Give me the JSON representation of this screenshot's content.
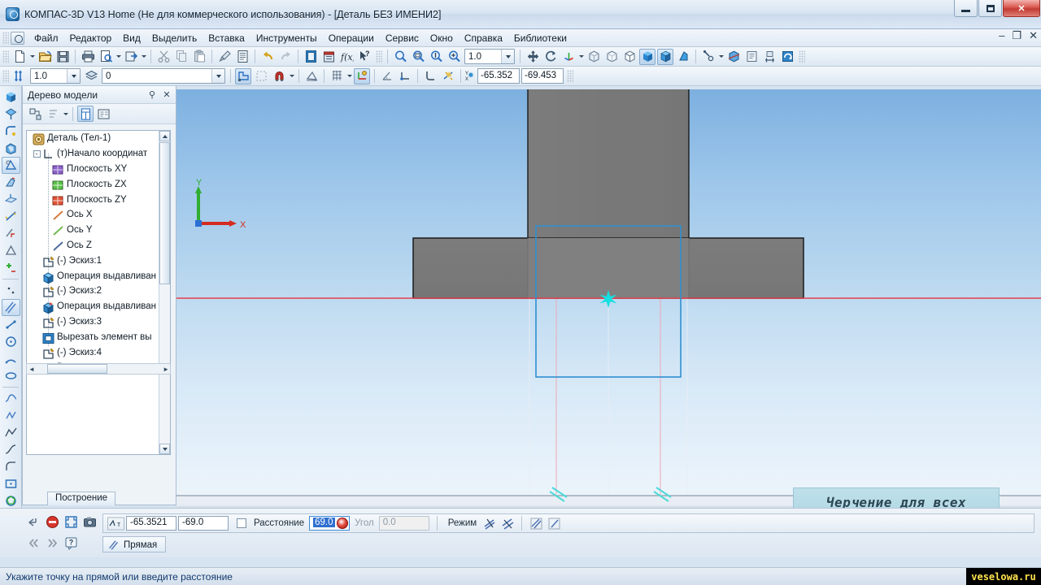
{
  "window": {
    "title": "КОМПАС-3D V13 Home (Не для коммерческого использования) - [Деталь БЕЗ ИМЕНИ2]",
    "app_icon": "kompas-logo-icon",
    "minimize_label": "—",
    "maximize_label": "□",
    "close_label": "✕",
    "doc_minimize_label": "–",
    "doc_restore_label": "❐",
    "doc_close_label": "✕"
  },
  "menu": {
    "items": [
      {
        "label": "Файл"
      },
      {
        "label": "Редактор"
      },
      {
        "label": "Вид"
      },
      {
        "label": "Выделить"
      },
      {
        "label": "Вставка"
      },
      {
        "label": "Инструменты"
      },
      {
        "label": "Операции"
      },
      {
        "label": "Сервис"
      },
      {
        "label": "Окно"
      },
      {
        "label": "Справка"
      },
      {
        "label": "Библиотеки"
      }
    ]
  },
  "toolbar_standard": {
    "buttons": [
      {
        "name": "new-document-icon",
        "glyph": "page"
      },
      {
        "name": "new-document-dropdown-icon",
        "glyph": "caret"
      },
      {
        "name": "open-document-icon",
        "glyph": "folder"
      },
      {
        "name": "save-document-icon",
        "glyph": "floppy"
      },
      {
        "name": "print-icon",
        "glyph": "printer"
      },
      {
        "name": "print-preview-icon",
        "glyph": "preview"
      },
      {
        "name": "print-preview-dropdown-icon",
        "glyph": "caret"
      },
      {
        "name": "send-document-icon",
        "glyph": "send"
      },
      {
        "name": "send-document-dropdown-icon",
        "glyph": "caret"
      },
      {
        "name": "cut-icon",
        "glyph": "scissors"
      },
      {
        "name": "copy-icon",
        "glyph": "copy"
      },
      {
        "name": "paste-icon",
        "glyph": "paste"
      },
      {
        "name": "format-painter-icon",
        "glyph": "brush"
      },
      {
        "name": "properties-icon",
        "glyph": "list"
      },
      {
        "name": "undo-icon",
        "glyph": "undo"
      },
      {
        "name": "redo-icon",
        "glyph": "redo"
      },
      {
        "name": "manager-icon",
        "glyph": "book"
      },
      {
        "name": "variables-icon",
        "glyph": "vars"
      },
      {
        "name": "expression-icon",
        "glyph": "fx"
      },
      {
        "name": "context-help-icon",
        "glyph": "help-arrow"
      }
    ],
    "zoom_buttons": [
      {
        "name": "zoom-window-icon",
        "glyph": "magnifier"
      },
      {
        "name": "zoom-fit-icon",
        "glyph": "magnifier-fit"
      },
      {
        "name": "zoom-in-out-icon",
        "glyph": "magnifier-scale"
      },
      {
        "name": "zoom-step-icon",
        "glyph": "magnifier-plus"
      }
    ],
    "zoom_value": "1.0",
    "view_buttons": [
      {
        "name": "pan-icon",
        "glyph": "move"
      },
      {
        "name": "rotate-icon",
        "glyph": "rotate"
      },
      {
        "name": "orientation-icon",
        "glyph": "orientation"
      },
      {
        "name": "orientation-dropdown-icon",
        "glyph": "caret"
      },
      {
        "name": "wireframe-icon",
        "glyph": "cube-wire"
      },
      {
        "name": "hidden-lines-thin-icon",
        "glyph": "cube-hidden"
      },
      {
        "name": "no-hidden-lines-icon",
        "glyph": "cube-nohidden"
      },
      {
        "name": "shaded-with-edges-icon",
        "glyph": "cube-solid-edge"
      },
      {
        "name": "shaded-icon",
        "glyph": "cube-solid"
      },
      {
        "name": "perspective-icon",
        "glyph": "cube-persp"
      },
      {
        "name": "display-settings-icon",
        "glyph": "display"
      },
      {
        "name": "display-settings-dropdown-icon",
        "glyph": "caret"
      },
      {
        "name": "section-icon",
        "glyph": "section"
      },
      {
        "name": "simplify-icon",
        "glyph": "simplify"
      },
      {
        "name": "measure-icon",
        "glyph": "measure"
      },
      {
        "name": "rebuild-icon",
        "glyph": "rebuild"
      }
    ]
  },
  "toolbar_current_state": {
    "line_style_value": "1.0",
    "layer_value": "0",
    "buttons": [
      {
        "name": "line-weight-icon",
        "glyph": "weights"
      },
      {
        "name": "layer-manager-icon",
        "glyph": "layers"
      },
      {
        "name": "sketch-mode-icon",
        "glyph": "sketch"
      },
      {
        "name": "sketch-hidden-icon",
        "glyph": "sketch2"
      },
      {
        "name": "parametric-mode-icon",
        "glyph": "magnet"
      },
      {
        "name": "parametric-dropdown-icon",
        "glyph": "caret"
      },
      {
        "name": "snap-setup-icon",
        "glyph": "snap"
      },
      {
        "name": "grid-icon",
        "glyph": "grid"
      },
      {
        "name": "grid-dropdown-icon",
        "glyph": "caret"
      },
      {
        "name": "local-cs-icon",
        "glyph": "lcs"
      },
      {
        "name": "restrict-angle-icon",
        "glyph": "angle"
      },
      {
        "name": "local-origin-icon",
        "glyph": "origin"
      },
      {
        "name": "orthogonal-icon",
        "glyph": "ortho"
      },
      {
        "name": "snap-toggle-icon",
        "glyph": "snaptoggle"
      }
    ],
    "cursor_label": "Y X",
    "cursor_x": "-65.352",
    "cursor_y": "-69.453"
  },
  "left_toolbar": {
    "buttons": [
      {
        "name": "extrude-operation-icon",
        "glyph": "cube-blue",
        "active": false
      },
      {
        "name": "cut-extrude-icon",
        "glyph": "cut-blue",
        "active": false
      },
      {
        "name": "fillet-icon",
        "glyph": "fillet",
        "active": false
      },
      {
        "name": "shell-icon",
        "glyph": "shell",
        "active": false
      },
      {
        "name": "draft-icon",
        "glyph": "draft",
        "active": true
      },
      {
        "name": "rib-icon",
        "glyph": "rib",
        "active": false
      },
      {
        "name": "plane-icon",
        "glyph": "plane",
        "active": false
      },
      {
        "name": "axis-icon",
        "glyph": "axis",
        "active": false
      },
      {
        "name": "perpendicular-plane-icon",
        "glyph": "perp",
        "active": false
      },
      {
        "name": "midplane-icon",
        "glyph": "midplane",
        "active": false
      },
      {
        "name": "point-tool-icon",
        "glyph": "point-star",
        "active": false
      },
      {
        "name": "point-icon",
        "glyph": "point",
        "active": false
      },
      {
        "name": "auxiliary-line-icon",
        "glyph": "lines",
        "active": true
      },
      {
        "name": "segment-icon",
        "glyph": "segment",
        "active": false
      },
      {
        "name": "circle-icon",
        "glyph": "circle",
        "active": false
      },
      {
        "name": "arc-icon",
        "glyph": "arc",
        "active": false
      },
      {
        "name": "ellipse-icon",
        "glyph": "ellipse",
        "active": false
      },
      {
        "name": "curve-icon",
        "glyph": "curve",
        "active": false
      },
      {
        "name": "bezier-icon",
        "glyph": "bezier",
        "active": false
      },
      {
        "name": "polyline-icon",
        "glyph": "polyline",
        "active": false
      },
      {
        "name": "spline-icon",
        "glyph": "spline",
        "active": false
      },
      {
        "name": "fillet-2d-icon",
        "glyph": "fillet2d",
        "active": false
      },
      {
        "name": "chamfer-2d-icon",
        "glyph": "chamfer2d",
        "active": false
      },
      {
        "name": "rectangle-icon",
        "glyph": "rect",
        "active": false
      },
      {
        "name": "polygon-icon",
        "glyph": "polygon",
        "active": false
      },
      {
        "name": "hatch-icon",
        "glyph": "hatch",
        "active": false
      },
      {
        "name": "equidistant-icon",
        "glyph": "equidistant",
        "active": false
      }
    ]
  },
  "tree_panel": {
    "title": "Дерево модели",
    "pin_label": "⚲",
    "close_label": "✕",
    "toolbar_buttons": [
      {
        "name": "tree-structure-icon",
        "glyph": "struct"
      },
      {
        "name": "tree-sort-icon",
        "glyph": "sort"
      },
      {
        "name": "tree-sort-dropdown-icon",
        "glyph": "caret"
      },
      {
        "name": "tree-view-mode-icon",
        "glyph": "viewmode",
        "active": true
      },
      {
        "name": "tree-detail-icon",
        "glyph": "detail"
      }
    ],
    "nodes": [
      {
        "label": "Деталь (Тел-1)",
        "icon": "part-icon",
        "indent": 0,
        "expander": ""
      },
      {
        "label": "(т)Начало координат",
        "icon": "origin-icon",
        "indent": 1,
        "expander": "-"
      },
      {
        "label": "Плоскость XY",
        "icon": "plane-xy-icon",
        "indent": 2,
        "expander": ""
      },
      {
        "label": "Плоскость ZX",
        "icon": "plane-zx-icon",
        "indent": 2,
        "expander": ""
      },
      {
        "label": "Плоскость ZY",
        "icon": "plane-zy-icon",
        "indent": 2,
        "expander": ""
      },
      {
        "label": "Ось X",
        "icon": "axis-x-icon",
        "indent": 2,
        "expander": ""
      },
      {
        "label": "Ось Y",
        "icon": "axis-y-icon",
        "indent": 2,
        "expander": ""
      },
      {
        "label": "Ось Z",
        "icon": "axis-z-icon",
        "indent": 2,
        "expander": ""
      },
      {
        "label": "(-) Эскиз:1",
        "icon": "sketch-icon",
        "indent": 1,
        "expander": ""
      },
      {
        "label": "Операция выдавливан",
        "icon": "extrude-icon",
        "indent": 1,
        "expander": ""
      },
      {
        "label": "(-) Эскиз:2",
        "icon": "sketch-icon",
        "indent": 1,
        "expander": ""
      },
      {
        "label": "Операция выдавливан",
        "icon": "extrude-icon",
        "indent": 1,
        "expander": ""
      },
      {
        "label": "(-) Эскиз:3",
        "icon": "sketch-icon",
        "indent": 1,
        "expander": ""
      },
      {
        "label": "Вырезать элемент вы",
        "icon": "cut-icon",
        "indent": 1,
        "expander": ""
      },
      {
        "label": "(-) Эскиз:4",
        "icon": "sketch-icon",
        "indent": 1,
        "expander": ""
      },
      {
        "label": "Вырезать элемент вы",
        "icon": "cut-icon",
        "indent": 1,
        "expander": ""
      }
    ],
    "bottom_tab": "Построение"
  },
  "viewport": {
    "axis_x_label": "X",
    "axis_y_label": "Y",
    "axis_x_color": "#d42b20",
    "axis_y_color": "#2fae31",
    "axis_z_color": "#2a6fd6",
    "model_fill": "#7b7b7b",
    "model_fill_light": "#8a8a8a",
    "model_edge": "#1b1b1b",
    "sketch_color": "#2f8fd0",
    "construction_color": "#ef9aa8",
    "red_axis_color": "#e8404b",
    "highlight_color": "#16e0e0",
    "watermark_line1": "Черчение для всех",
    "watermark_line2": "veselowa.ru"
  },
  "property_bar": {
    "command_buttons": [
      {
        "name": "autocreate-object-icon",
        "glyph": "auto"
      },
      {
        "name": "interrupt-command-icon",
        "glyph": "stop"
      },
      {
        "name": "maximize-view-icon",
        "glyph": "expand"
      },
      {
        "name": "snapshot-icon",
        "glyph": "camera"
      },
      {
        "name": "prev-step-icon",
        "glyph": "prev"
      },
      {
        "name": "next-step-icon",
        "glyph": "next"
      },
      {
        "name": "command-help-icon",
        "glyph": "help"
      }
    ],
    "point_mode_label": "т",
    "x_value": "-65.3521",
    "y_value": "-69.0",
    "distance_checkbox_label": "Расстояние",
    "distance_value": "69.0",
    "angle_label": "Угол",
    "angle_value": "0.0",
    "mode_label": "Режим",
    "mode_buttons": [
      {
        "name": "mode-nonparallel-icon",
        "glyph": "m1"
      },
      {
        "name": "mode-parallel-icon",
        "glyph": "m2"
      },
      {
        "name": "mode-hatch-both-icon",
        "glyph": "m3"
      },
      {
        "name": "mode-hatch-single-icon",
        "glyph": "m4"
      }
    ],
    "command_tab_label": "Прямая",
    "command_tab_icon": "line-icon"
  },
  "status_bar": {
    "message": "Укажите точку на прямой или введите расстояние",
    "watermark": "veselowa.ru"
  }
}
